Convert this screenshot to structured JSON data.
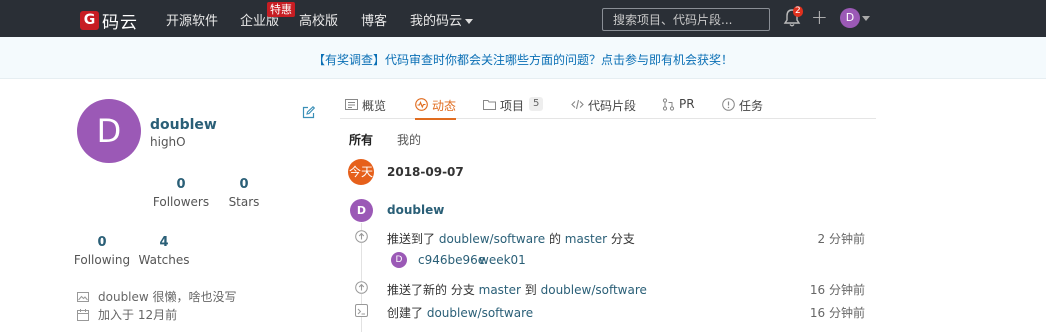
{
  "nav": {
    "logo_glyph": "G",
    "logo_text": "码云",
    "links": [
      "开源软件",
      "企业版",
      "高校版",
      "博客",
      "我的码云"
    ],
    "special_badge": "特惠",
    "search_placeholder": "搜索项目、代码片段...",
    "notification_count": "2",
    "plus_glyph": "+",
    "avatar_letter": "D"
  },
  "banner": {
    "text": "【有奖调查】代码审查时你都会关注哪些方面的问题？点击参与即有机会获奖！"
  },
  "profile": {
    "avatar_letter": "D",
    "name": "doublew",
    "handle": "highO",
    "stats": [
      {
        "value": "0",
        "label": "Followers"
      },
      {
        "value": "0",
        "label": "Stars"
      },
      {
        "value": "0",
        "label": "Following"
      },
      {
        "value": "4",
        "label": "Watches"
      }
    ],
    "bio": "doublew 很懒，啥也没写",
    "joined": "加入于 12月前"
  },
  "tabs": [
    {
      "label": "概览",
      "icon": "overview-icon"
    },
    {
      "label": "动态",
      "icon": "activity-icon"
    },
    {
      "label": "项目",
      "icon": "folder-icon",
      "count": "5"
    },
    {
      "label": "代码片段",
      "icon": "code-icon"
    },
    {
      "label": "PR",
      "icon": "pull-request-icon"
    },
    {
      "label": "任务",
      "icon": "issue-icon"
    }
  ],
  "subtabs": [
    "所有",
    "我的"
  ],
  "timeline": {
    "today_label": "今天",
    "date": "2018-09-07",
    "user_letter": "D",
    "user": "doublew",
    "events": [
      {
        "prefix": "推送到了 ",
        "repo": "doublew/software",
        "middle": " 的 ",
        "branch": "master",
        "suffix": " 分支",
        "time": "2 分钟前"
      },
      {
        "prefix": "推送了新的 分支 ",
        "branch": "master",
        "middle": " 到 ",
        "repo": "doublew/software",
        "time": "16 分钟前"
      },
      {
        "prefix": "创建了 ",
        "repo": "doublew/software",
        "time": "16 分钟前"
      }
    ],
    "commit": {
      "avatar_letter": "D",
      "hash": "c946be96e",
      "message": "week01"
    }
  },
  "colors": {
    "nav_bg": "#2a2f36",
    "brand_red": "#c71d23",
    "accent_orange": "#e06c1f",
    "avatar_purple": "#9b59b6",
    "link_blue": "#2a5f77"
  }
}
